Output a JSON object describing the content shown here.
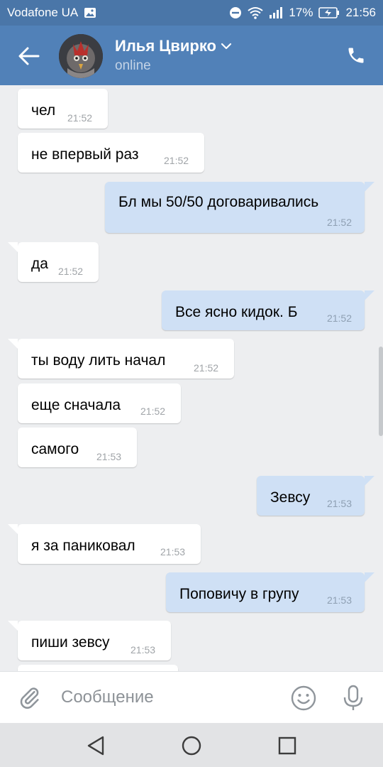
{
  "status_bar": {
    "carrier": "Vodafone UA",
    "battery": "17%",
    "time": "21:56",
    "icons": [
      "image-icon",
      "do-not-disturb-icon",
      "wifi-icon",
      "signal-icon",
      "battery-charging-icon"
    ]
  },
  "header": {
    "name": "Илья Цвирко",
    "status": "online",
    "icons": [
      "back-arrow-icon",
      "avatar",
      "chevron-down-icon",
      "phone-icon"
    ]
  },
  "messages": [
    {
      "dir": "in",
      "text": "чел",
      "time": "21:52"
    },
    {
      "dir": "in",
      "text": "не впервый раз",
      "time": "21:52"
    },
    {
      "dir": "out",
      "text": "Бл мы 50/50 договаривались",
      "time": "21:52"
    },
    {
      "dir": "in",
      "text": "да",
      "time": "21:52"
    },
    {
      "dir": "out",
      "text": "Все ясно кидок. Б",
      "time": "21:52"
    },
    {
      "dir": "in",
      "text": "ты воду лить начал",
      "time": "21:52"
    },
    {
      "dir": "in",
      "text": "еще сначала",
      "time": "21:52"
    },
    {
      "dir": "in",
      "text": "самого",
      "time": "21:53"
    },
    {
      "dir": "out",
      "text": "Зевсу",
      "time": "21:53"
    },
    {
      "dir": "in",
      "text": "я за паниковал",
      "time": "21:53"
    },
    {
      "dir": "out",
      "text": "Поповичу в групу",
      "time": "21:53"
    },
    {
      "dir": "in",
      "text": "пиши зевсу",
      "time": "21:53"
    }
  ],
  "input": {
    "placeholder": "Сообщение",
    "icons": [
      "paperclip-icon",
      "emoji-icon",
      "microphone-icon"
    ]
  },
  "nav_bar": {
    "icons": [
      "nav-back-icon",
      "nav-home-icon",
      "nav-recents-icon"
    ]
  },
  "colors": {
    "header": "#5181b8",
    "status_bar": "#4a76a8",
    "background": "#edeef0",
    "incoming_bubble": "#ffffff",
    "outgoing_bubble": "#cfe0f5"
  }
}
